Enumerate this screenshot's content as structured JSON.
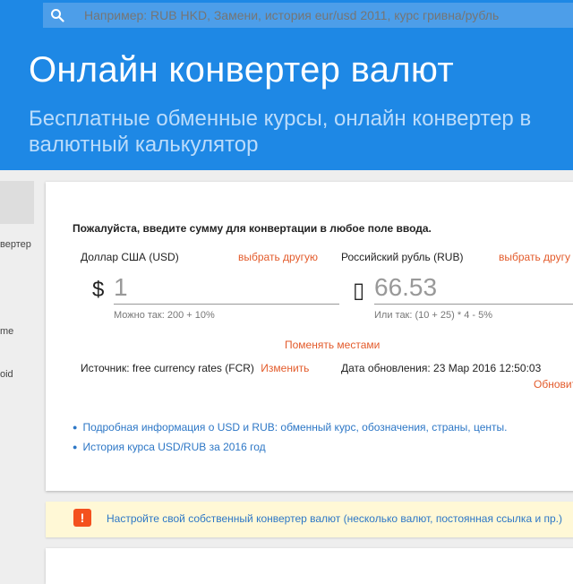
{
  "search": {
    "placeholder": "Например: RUB HKD, Замени, история eur/usd 2011, курс гривна/рубль"
  },
  "hero": {
    "title": "Онлайн конвертер валют",
    "subtitle_line1": "Бесплатные обменные курсы, онлайн конвертер в",
    "subtitle_line2": "валютный калькулятор"
  },
  "sidebar": {
    "items": [
      "вертер",
      "me",
      "oid"
    ]
  },
  "converter": {
    "instruction": "Пожалуйста, введите сумму для конвертации в любое поле ввода.",
    "from": {
      "label": "Доллар США (USD)",
      "choose_label": "выбрать другую",
      "symbol": "$",
      "value": "1",
      "hint": "Можно так: 200 + 10%"
    },
    "to": {
      "label": "Российский рубль (RUB)",
      "choose_label": "выбрать другу",
      "symbol": "▯",
      "value": "66.53",
      "hint": "Или так: (10 + 25) * 4 - 5%"
    },
    "swap_label": "Поменять местами",
    "source_label": "Источник: free currency rates (FCR)",
    "change_label": "Изменить",
    "updated_label": "Дата обновления: 23 Мар 2016 12:50:03",
    "refresh_label": "Обновит"
  },
  "info_links": [
    "Подробная информация о USD и RUB: обменный курс, обозначения, страны, центы.",
    "История курса USD/RUB за 2016 год"
  ],
  "notice": {
    "icon": "exclamation-icon",
    "text": "Настройте свой собственный конвертер валют (несколько валют, постоянная ссылка и пр.)"
  },
  "colors": {
    "primary": "#1e88e5",
    "link_orange": "#e35b2b",
    "link_blue": "#2d77c6",
    "notice_bg": "#fff8d6"
  }
}
